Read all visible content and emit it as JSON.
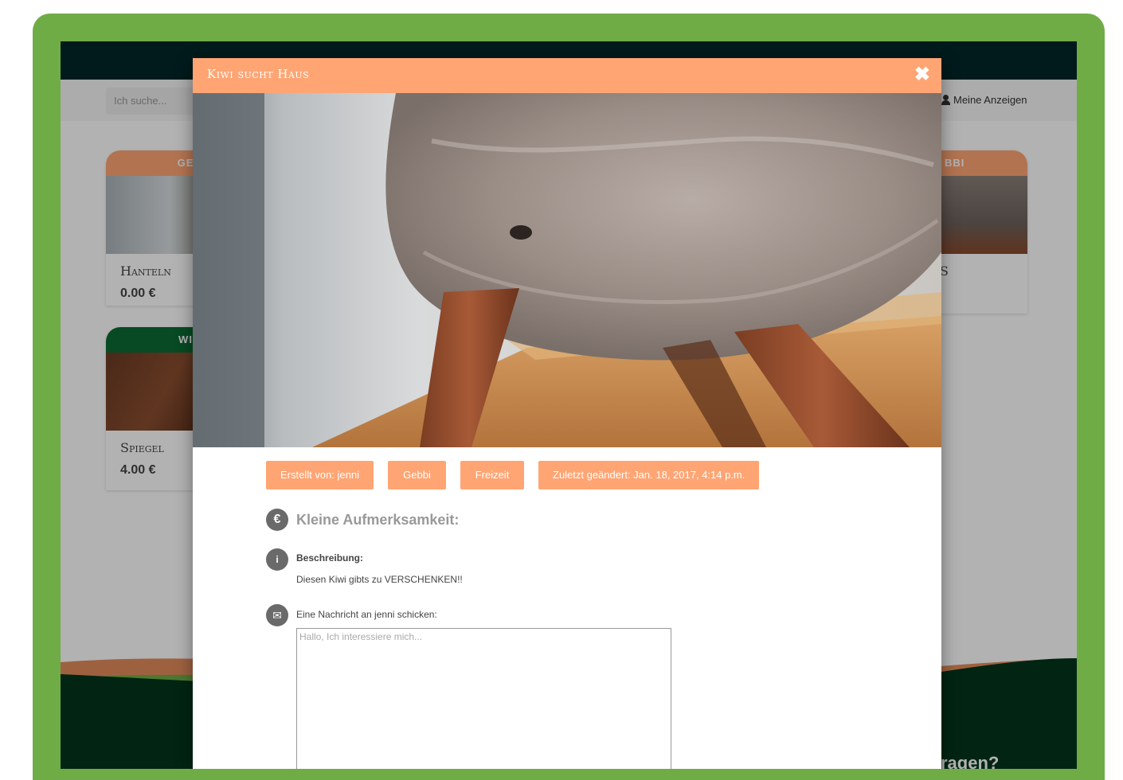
{
  "background": {
    "search_placeholder": "Ich suche...",
    "my_ads_label": "Meine Anzeigen",
    "cards": [
      {
        "category": "GE",
        "title": "Hanteln",
        "price": "0.00 €"
      },
      {
        "category": "WI",
        "title": "Spiegel",
        "price": "4.00 €"
      },
      {
        "category": "BBI",
        "title": "S"
      }
    ],
    "footer_partial_text": "ragen?"
  },
  "modal": {
    "title": "Kiwi sucht Haus",
    "close_icon": "close-icon",
    "tags": {
      "created_by": "Erstellt von: jenni",
      "location": "Gebbi",
      "category": "Freizeit",
      "last_modified": "Zuletzt geändert: Jan. 18, 2017, 4:14 p.m."
    },
    "price_icon_glyph": "€",
    "price_label": "Kleine Aufmerksamkeit:",
    "description_icon_glyph": "i",
    "description_label": "Beschreibung:",
    "description_text": "Diesen Kiwi gibts zu VERSCHENKEN!!",
    "message_icon_glyph": "✉",
    "message_label": "Eine Nachricht an jenni schicken:",
    "message_placeholder": "Hallo, Ich interessiere mich..."
  },
  "colors": {
    "frame_green": "#6fac46",
    "accent_orange": "#ffa574",
    "dark_teal": "#022627",
    "card_green_head": "#0b6b33"
  }
}
